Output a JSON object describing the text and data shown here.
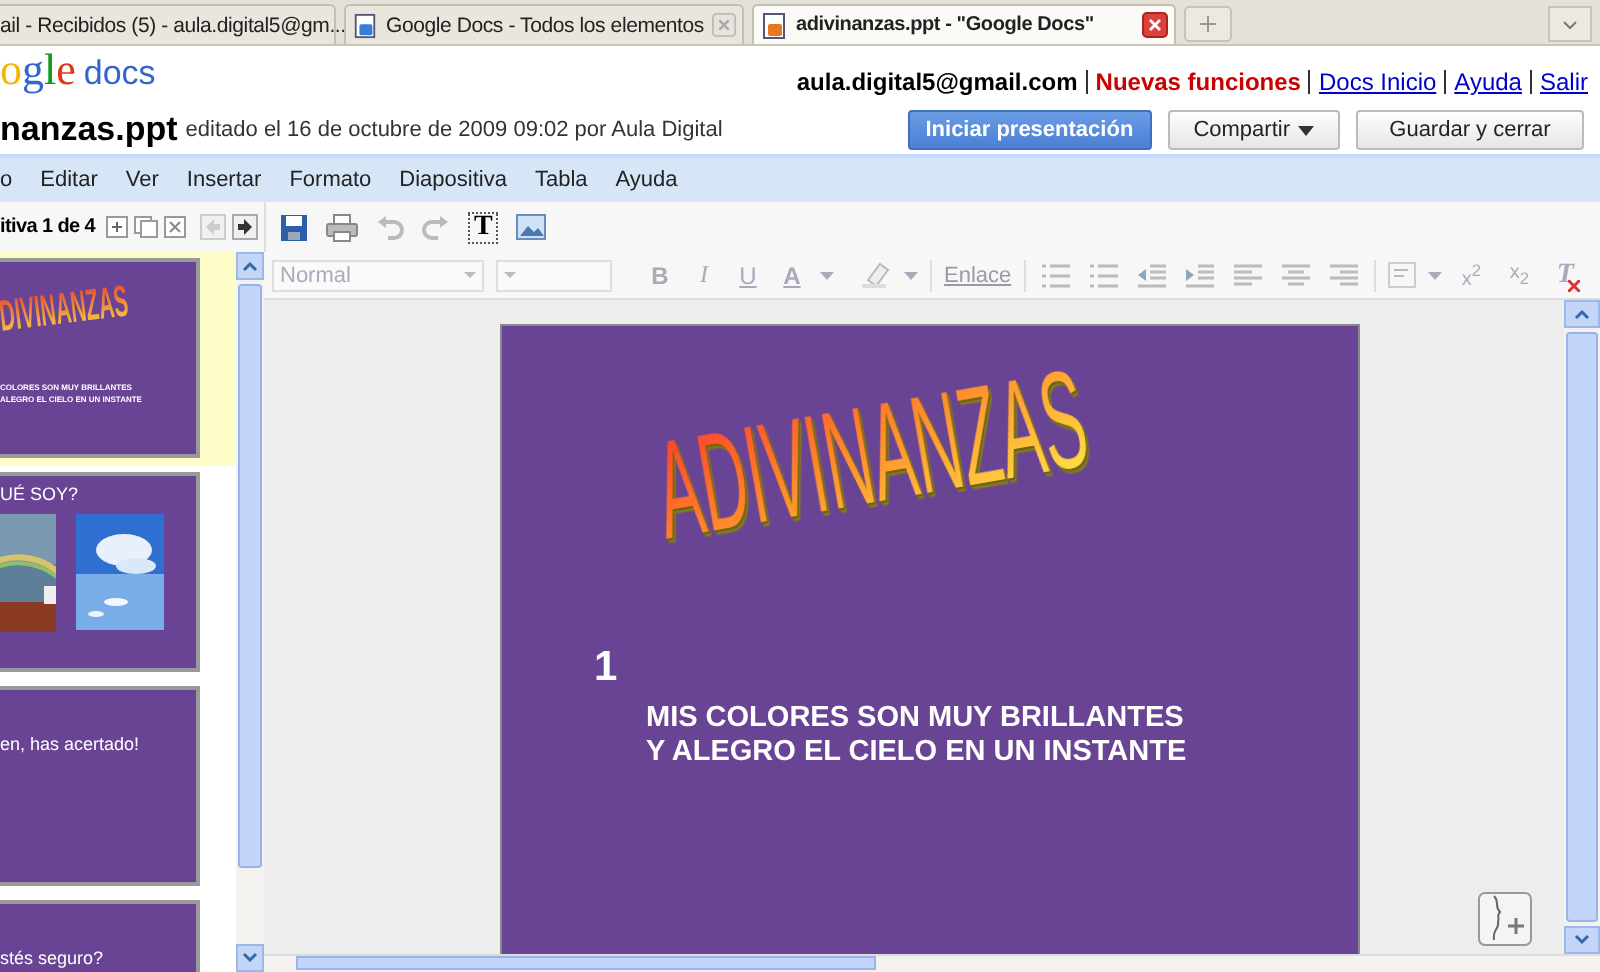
{
  "browser_tabs": [
    {
      "title": "ail - Recibidos (5) - aula.digital5@gm...",
      "selected": false
    },
    {
      "title": "Google Docs - Todos los elementos",
      "selected": false
    },
    {
      "title": "adivinanzas.ppt - \"Google Docs\"",
      "selected": true
    }
  ],
  "header": {
    "logo": "ogle",
    "logo_product": "docs",
    "account": "aula.digital5@gmail.com",
    "links": [
      {
        "label": "Nuevas funciones",
        "kind": "highlight"
      },
      {
        "label": "Docs Inicio",
        "kind": "link"
      },
      {
        "label": "Ayuda",
        "kind": "link"
      },
      {
        "label": "Salir",
        "kind": "link"
      }
    ]
  },
  "document": {
    "title": "nanzas.ppt",
    "edited": "editado el 16 de octubre de 2009 09:02 por Aula Digital"
  },
  "buttons": [
    {
      "label": "Iniciar presentación",
      "kind": "primary"
    },
    {
      "label": "Compartir",
      "kind": "menu"
    },
    {
      "label": "Guardar y cerrar",
      "kind": "plain"
    }
  ],
  "menu": [
    "o",
    "Editar",
    "Ver",
    "Insertar",
    "Formato",
    "Diapositiva",
    "Tabla",
    "Ayuda"
  ],
  "slide_nav": {
    "counter": "itiva 1 de 4"
  },
  "insert_toolbar": {
    "text_box": "T"
  },
  "format_toolbar": {
    "disabled": true,
    "style": "Normal",
    "bold": "B",
    "italic": "I",
    "underline": "U",
    "text_color": "A",
    "link": "Enlace",
    "superscript": "x$^{2}$",
    "subscript": "x$_{2}$",
    "clear": "T"
  },
  "thumbnails": [
    {
      "kind": "title",
      "selected": true,
      "title": "DIVINANZAS",
      "lines": [
        "COLORES SON MUY BRILLANTES",
        "ALEGRO EL CIELO EN UN INSTANTE"
      ]
    },
    {
      "kind": "pictures",
      "selected": false,
      "title": "UÉ SOY?"
    },
    {
      "kind": "text",
      "selected": false,
      "title": "en, has acertado!"
    },
    {
      "kind": "text",
      "selected": false,
      "title": "stés seguro?"
    }
  ],
  "slide": {
    "title": "ADIVINANZAS",
    "number": "1",
    "lines": [
      "MIS COLORES SON MUY BRILLANTES",
      "Y ALEGRO EL CIELO EN UN INSTANTE"
    ]
  }
}
